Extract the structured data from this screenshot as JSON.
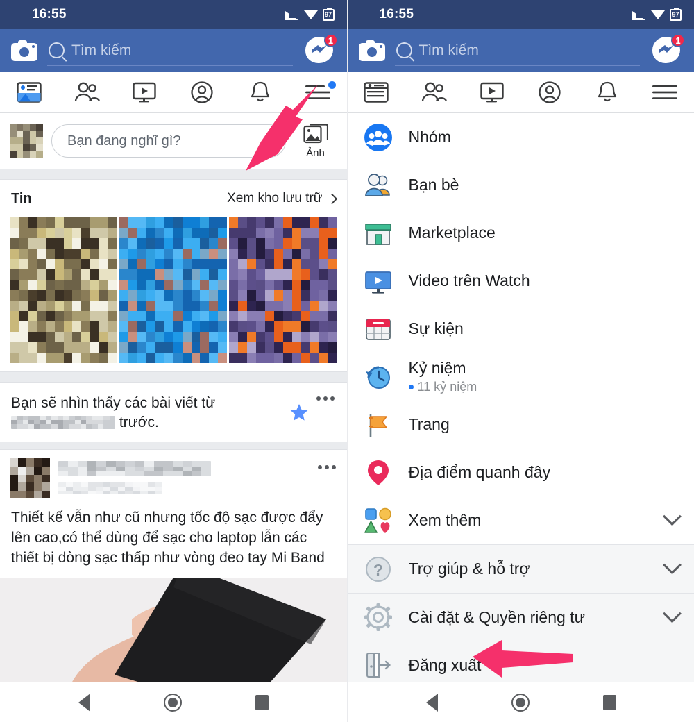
{
  "status_bar": {
    "time": "16:55",
    "battery": "97",
    "signal_icon": "signal-icon",
    "wifi_icon": "wifi-icon",
    "battery_icon": "battery-icon"
  },
  "header": {
    "camera_icon": "camera-icon",
    "search_icon": "search-icon",
    "search_placeholder": "Tìm kiếm",
    "messenger_icon": "messenger-icon",
    "messenger_badge": "1"
  },
  "tabs": [
    {
      "name": "tab-news-feed",
      "icon": "news-feed-icon"
    },
    {
      "name": "tab-friends",
      "icon": "friends-icon"
    },
    {
      "name": "tab-watch",
      "icon": "watch-video-icon"
    },
    {
      "name": "tab-profile",
      "icon": "profile-icon"
    },
    {
      "name": "tab-notifications",
      "icon": "bell-icon"
    },
    {
      "name": "tab-menu",
      "icon": "hamburger-menu-icon",
      "has_dot": true
    }
  ],
  "composer": {
    "placeholder": "Bạn đang nghĩ gì?",
    "photo_label": "Ảnh",
    "photo_icon": "photo-icon",
    "avatar_icon": "avatar"
  },
  "stories": {
    "title": "Tin",
    "archive_label": "Xem kho lưu trữ",
    "chevron_icon": "chevron-right-icon",
    "items": [
      {
        "name": "story-1"
      },
      {
        "name": "story-2"
      },
      {
        "name": "story-3"
      }
    ]
  },
  "notice": {
    "text_before": "Bạn sẽ nhìn thấy các bài viết từ",
    "text_after": "trước.",
    "star_icon": "star-icon",
    "menu_icon": "more-options-icon"
  },
  "post": {
    "menu_icon": "more-options-icon",
    "body": "Thiết kế vẫn như cũ nhưng tốc độ sạc được đẩy lên cao,có thể dùng để sạc cho laptop lẫn các thiết bị dòng sạc thấp như vòng đeo tay Mi Band",
    "image_alt": "hand-holding-phone-photo"
  },
  "menu": {
    "items": [
      {
        "name": "menu-item-groups",
        "label": "Nhóm",
        "icon": "groups-icon",
        "chevron": false
      },
      {
        "name": "menu-item-friends",
        "label": "Bạn bè",
        "icon": "friends-icon",
        "chevron": false
      },
      {
        "name": "menu-item-marketplace",
        "label": "Marketplace",
        "icon": "marketplace-icon",
        "chevron": false
      },
      {
        "name": "menu-item-watch",
        "label": "Video trên Watch",
        "icon": "watch-icon",
        "chevron": false
      },
      {
        "name": "menu-item-events",
        "label": "Sự kiện",
        "icon": "calendar-icon",
        "chevron": false
      },
      {
        "name": "menu-item-memories",
        "label": "Kỷ niệm",
        "icon": "memories-icon",
        "chevron": false,
        "sub": "11 kỷ niệm"
      },
      {
        "name": "menu-item-pages",
        "label": "Trang",
        "icon": "flag-icon",
        "chevron": false
      },
      {
        "name": "menu-item-nearby",
        "label": "Địa điểm quanh đây",
        "icon": "location-pin-icon",
        "chevron": false
      },
      {
        "name": "menu-item-see-more",
        "label": "Xem thêm",
        "icon": "see-more-icon",
        "chevron": true
      }
    ],
    "footer_items": [
      {
        "name": "menu-item-help",
        "label": "Trợ giúp & hỗ trợ",
        "icon": "help-circle-icon",
        "chevron": true
      },
      {
        "name": "menu-item-settings",
        "label": "Cài đặt & Quyền riêng tư",
        "icon": "gear-icon",
        "chevron": true
      },
      {
        "name": "menu-item-logout",
        "label": "Đăng xuất",
        "icon": "logout-icon",
        "chevron": false
      }
    ]
  },
  "android_nav": {
    "back_icon": "back-nav-icon",
    "home_icon": "home-nav-icon",
    "recents_icon": "recents-nav-icon"
  },
  "annotations": {
    "arrow_color": "#f5306b",
    "arrow_left_target": "hamburger-menu-icon",
    "arrow_right_target": "menu-item-logout"
  },
  "colors": {
    "status_bar": "#2e4372",
    "header_blue": "#4267ad",
    "badge_red": "#f02849",
    "accent_blue": "#2078f4",
    "divider": "#dddfe2"
  }
}
